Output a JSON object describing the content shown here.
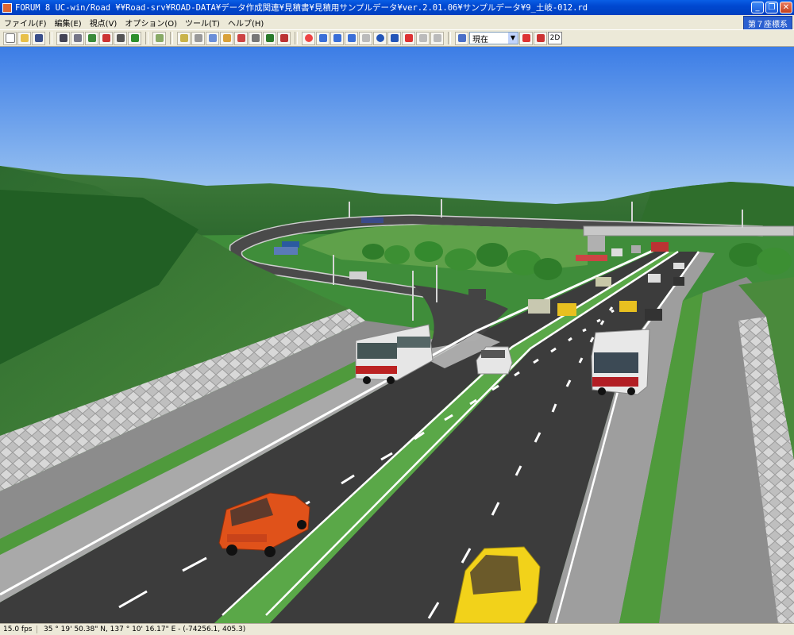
{
  "window": {
    "title": "FORUM 8    UC-win/Road    ¥¥Road-srv¥ROAD-DATA¥データ作成関連¥見積書¥見積用サンプルデータ¥ver.2.01.06¥サンプルデータ¥9_土岐-012.rd",
    "minimize": "_",
    "maximize": "❐",
    "close": "✕"
  },
  "menu": {
    "items": [
      "ファイル(F)",
      "編集(E)",
      "視点(V)",
      "オプション(O)",
      "ツール(T)",
      "ヘルプ(H)"
    ],
    "coord_system": "第７座標系"
  },
  "toolbar": {
    "viewpoint_select": "現在",
    "mode_2d": "2D"
  },
  "status": {
    "fps": "15.0 fps",
    "coordinates": "35 °  19' 50.38\" N, 137 °  10' 16.17\" E  -  (-74256.1, 405.3)"
  }
}
